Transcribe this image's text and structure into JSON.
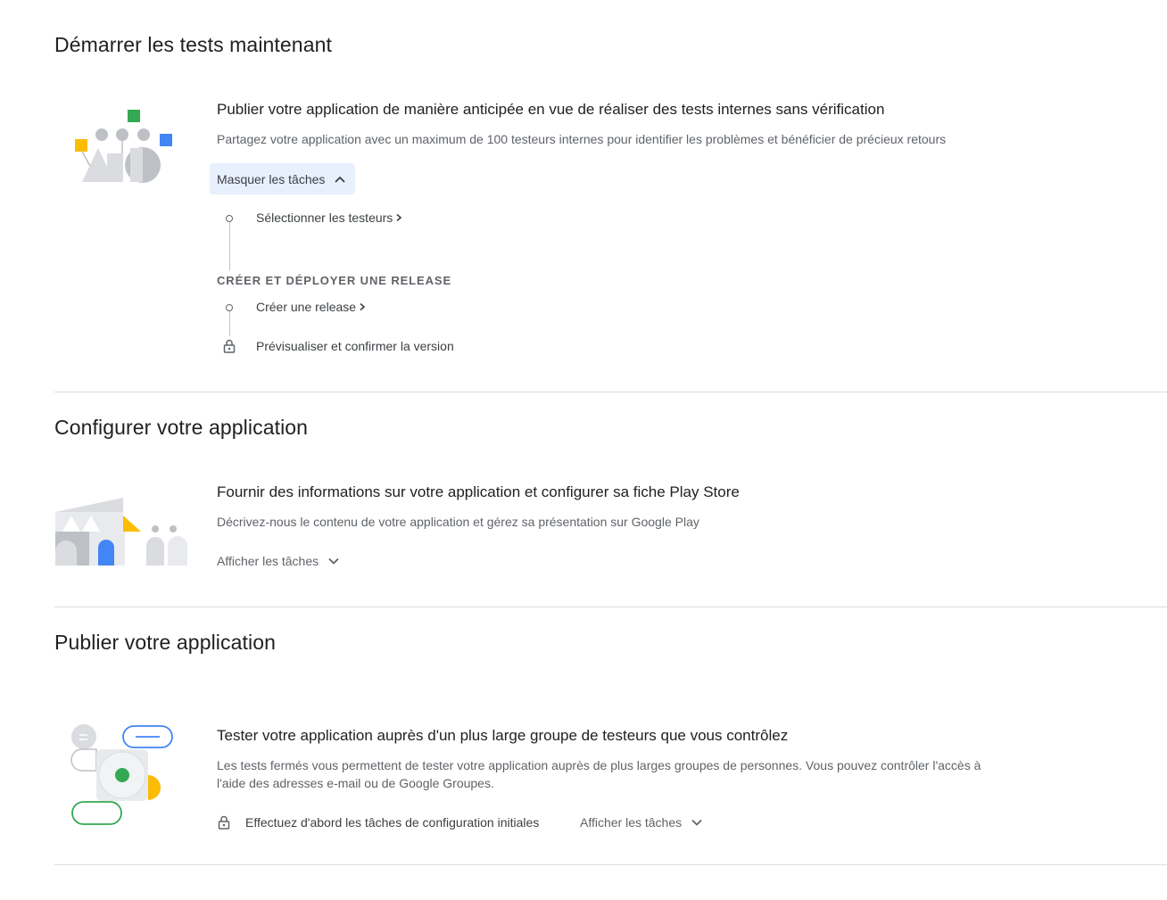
{
  "sections": [
    {
      "title": "Démarrer les tests maintenant",
      "card": {
        "title": "Publier votre application de manière anticipée en vue de réaliser des tests internes sans vérification",
        "description": "Partagez votre application avec un maximum de 100 testeurs internes pour identifier les problèmes et bénéficier de précieux retours",
        "toggle_label": "Masquer les tâches",
        "tasks": [
          {
            "label": "Sélectionner les testeurs",
            "status": "open"
          }
        ],
        "group_label": "CRÉER ET DÉPLOYER UNE RELEASE",
        "group_tasks": [
          {
            "label": "Créer une release",
            "status": "open"
          },
          {
            "label": "Prévisualiser et confirmer la version",
            "status": "locked"
          }
        ]
      }
    },
    {
      "title": "Configurer votre application",
      "card": {
        "title": "Fournir des informations sur votre application et configurer sa fiche Play Store",
        "description": "Décrivez-nous le contenu de votre application et gérez sa présentation sur Google Play",
        "toggle_label": "Afficher les tâches"
      }
    },
    {
      "title": "Publier votre application",
      "card": {
        "title": "Tester votre application auprès d'un plus large groupe de testeurs que vous contrôlez",
        "description_line1": "Les tests fermés vous permettent de tester votre application auprès de plus larges groupes de personnes. Vous pouvez contrôler l'accès à",
        "description_line2": "l'aide des adresses e-mail ou de Google Groupes.",
        "locked_note": "Effectuez d'abord les tâches de configuration initiales",
        "toggle_label": "Afficher les tâches"
      }
    }
  ],
  "colors": {
    "green": "#34a853",
    "yellow": "#fbbc04",
    "blue": "#4285f4",
    "grey": "#bdc1c6",
    "light_grey": "#dadce0"
  }
}
